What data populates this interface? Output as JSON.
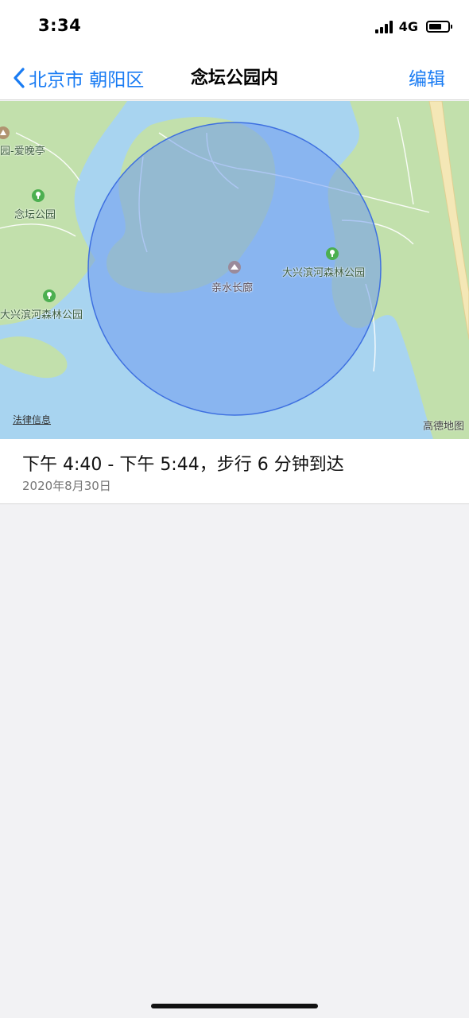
{
  "status_bar": {
    "time": "3:34",
    "network": "4G",
    "battery_level": 0.7
  },
  "nav": {
    "back_label": "北京市 朝阳区",
    "title": "念坛公园内",
    "edit_label": "编辑"
  },
  "map": {
    "labels": {
      "pavilion": "园-爱晚亭",
      "niantan_park": "念坛公园",
      "daxing_forest_park_east": "大兴滨河森林公园",
      "daxing_forest_park_west": "大兴滨河森林公园",
      "waterside_corridor": "亲水长廊"
    },
    "legal_link": "法律信息",
    "attribution": "高德地图",
    "colors": {
      "water": "#a8d4f0",
      "park": "#c2e0ac",
      "region_fill": "#6f9bf0",
      "region_stroke": "#3d6fe0",
      "poi_green": "#4caf50"
    }
  },
  "visit": {
    "time_range": "下午 4:40 - 下午 5:44，步行 6 分钟到达",
    "date": "2020年8月30日"
  },
  "accent_color": "#1a7cf3"
}
